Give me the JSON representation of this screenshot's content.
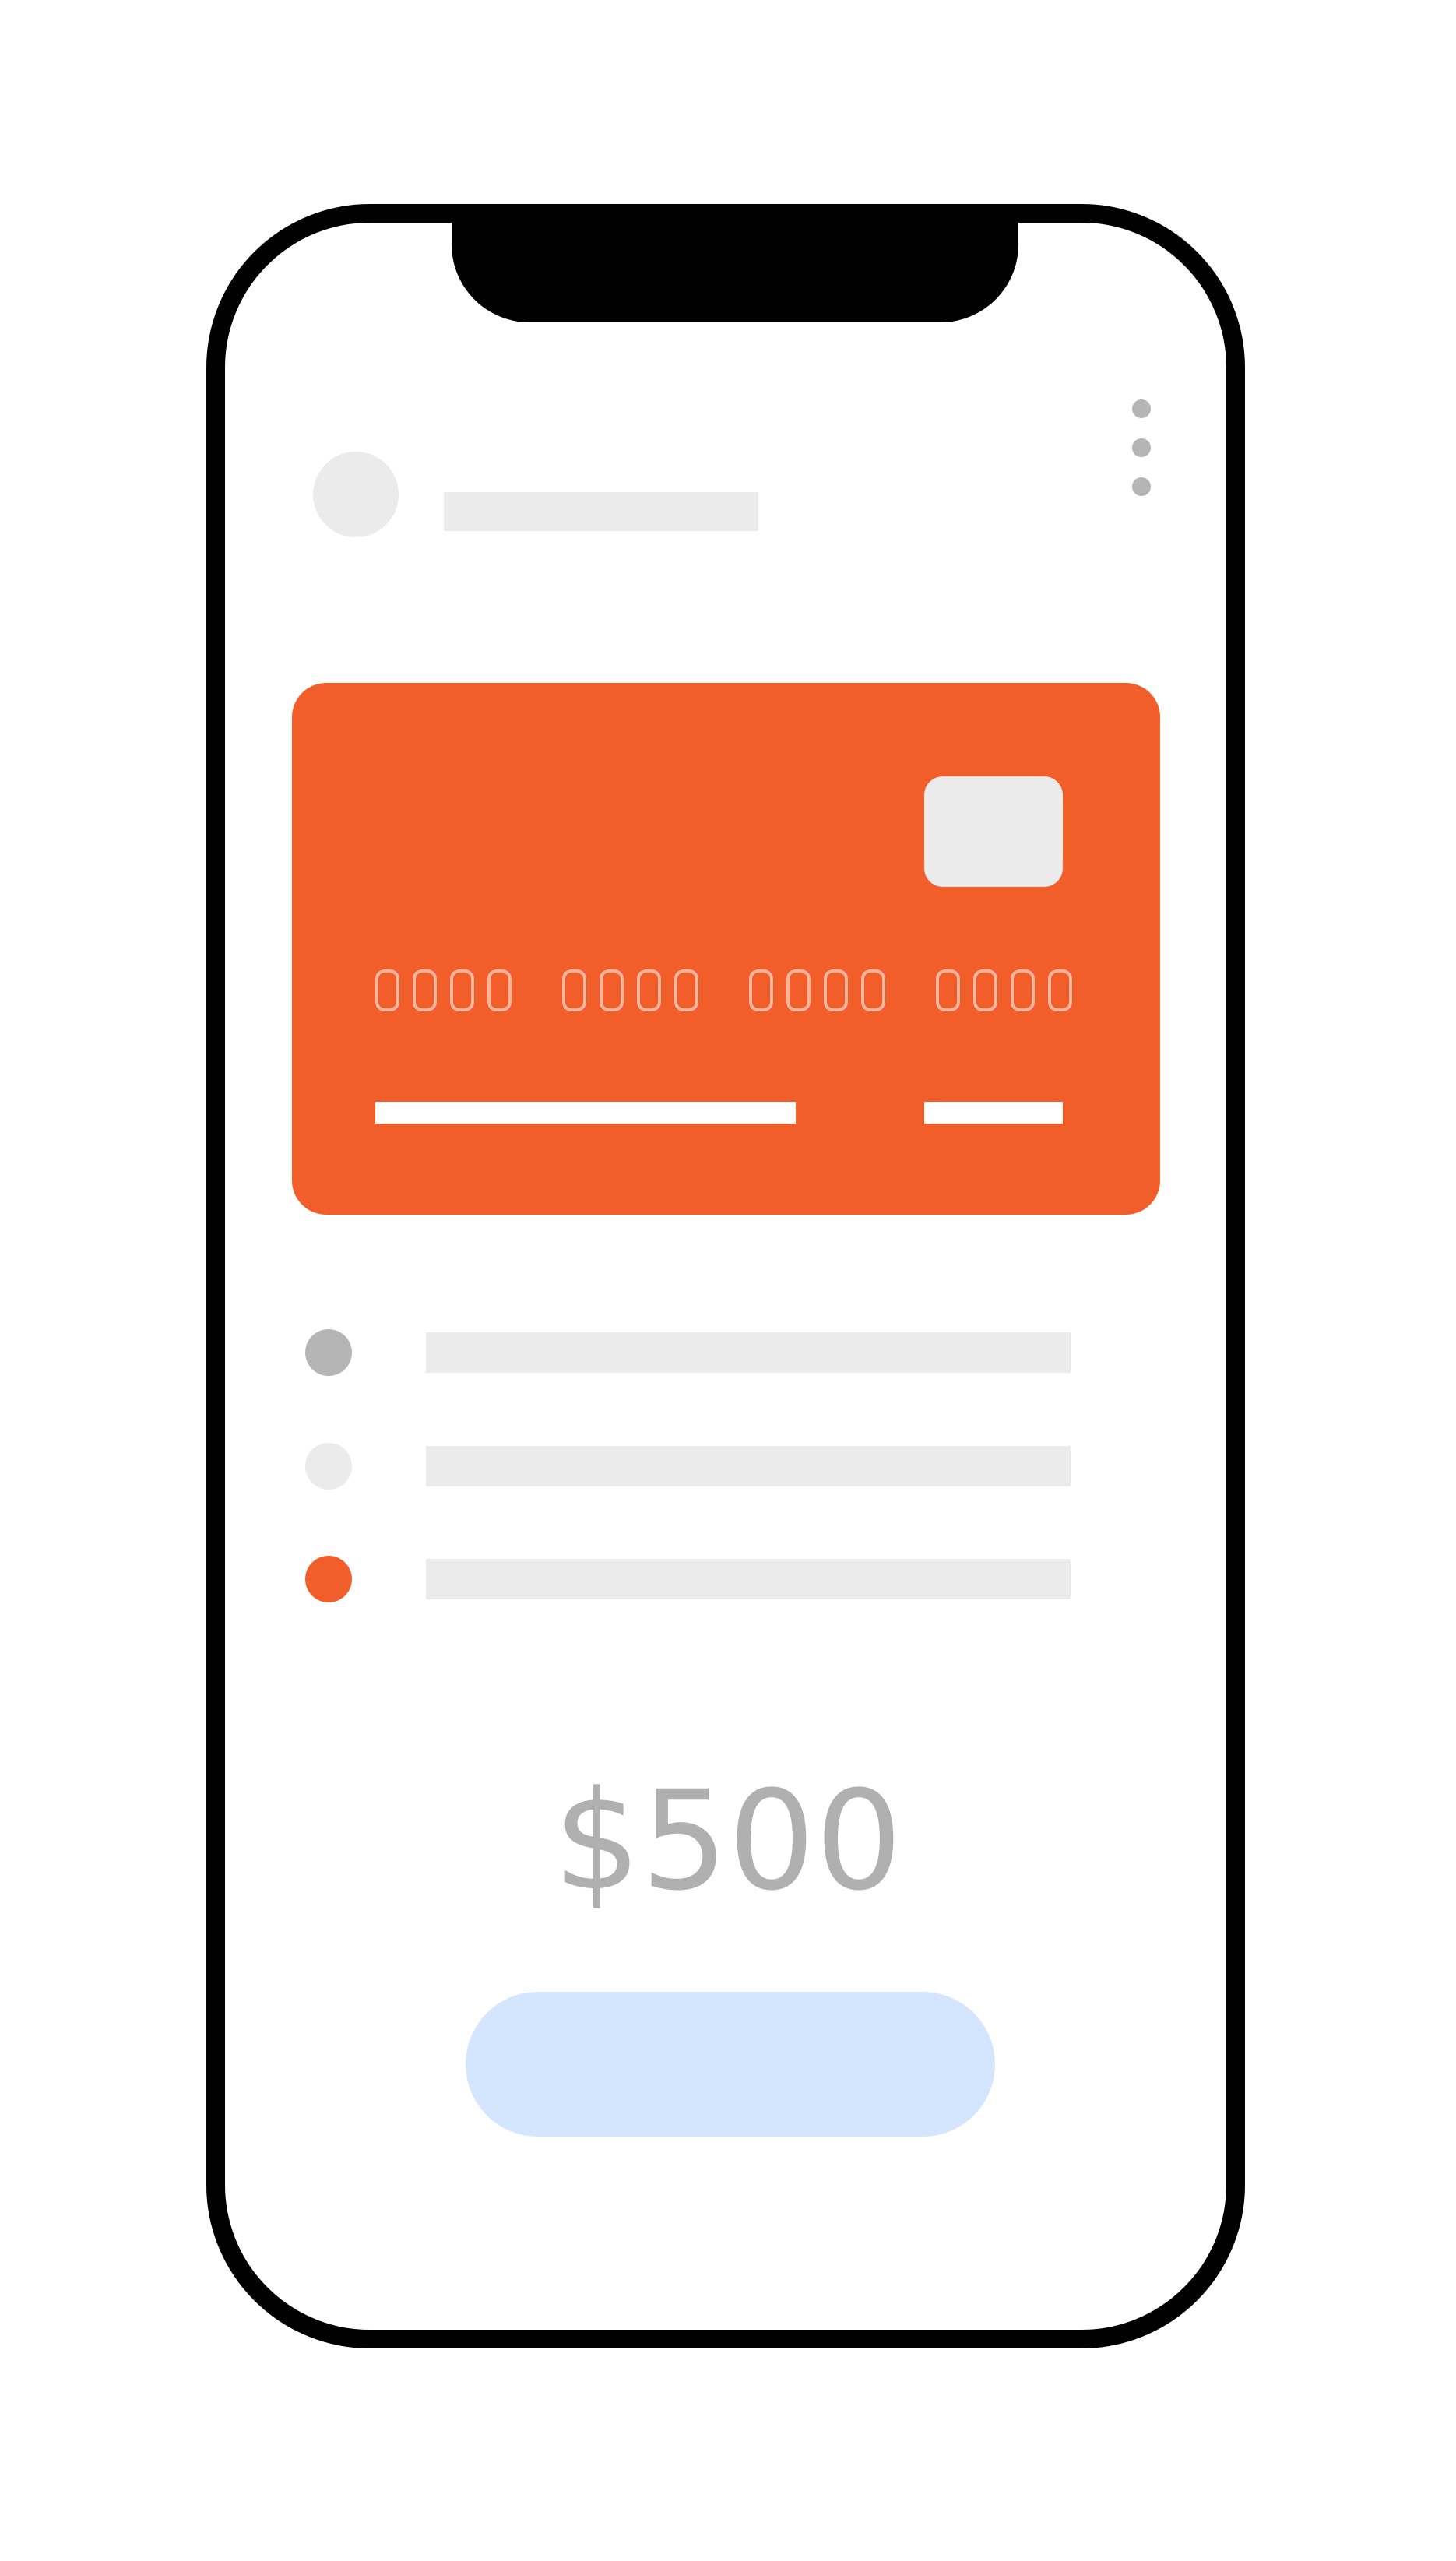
{
  "colors": {
    "frame": "#000000",
    "accent": "#f15e29",
    "placeholder": "#ebebeb",
    "muted": "#b5b5b5",
    "card_digit_outline": "#f9b59d",
    "button": "#d4e6fd",
    "amount_text": "#b0b0b0"
  },
  "header": {
    "menu_icon": "kebab-menu-icon"
  },
  "payment": {
    "amount": "$500"
  },
  "options": [
    {
      "state": "selected-gray",
      "color": "#b5b5b5"
    },
    {
      "state": "unselected",
      "color": "#ebebeb"
    },
    {
      "state": "selected-accent",
      "color": "#f15e29"
    }
  ]
}
